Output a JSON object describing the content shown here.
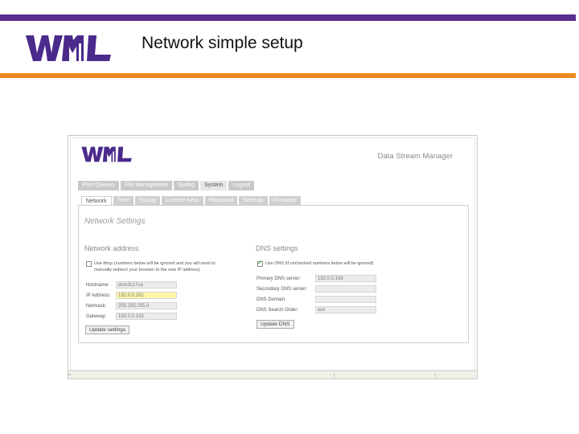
{
  "slide": {
    "title": "Network simple setup",
    "colors": {
      "top_bar": "#5a2d91",
      "bottom_bar": "#f08a1e",
      "logo": "#4b2a8c"
    },
    "logo_icon": "wml-logo"
  },
  "app": {
    "title": "Data Stream Manager",
    "logo_icon": "wml-logo",
    "main_tabs": [
      {
        "label": "Print Queues",
        "active": false
      },
      {
        "label": "File Management",
        "active": false
      },
      {
        "label": "Syslog",
        "active": false
      },
      {
        "label": "System",
        "active": true
      },
      {
        "label": "Logout",
        "active": false
      }
    ],
    "sub_tabs": [
      {
        "label": "Network",
        "active": true
      },
      {
        "label": "Time",
        "active": false
      },
      {
        "label": "Syslog",
        "active": false
      },
      {
        "label": "Licence Keys",
        "active": false
      },
      {
        "label": "Password",
        "active": false
      },
      {
        "label": "Settings",
        "active": false
      },
      {
        "label": "Firmware",
        "active": false
      }
    ],
    "panel_title": "Network Settings",
    "network": {
      "title": "Network address",
      "dhcp_label": "Use dhcp (numbers below will be ignored and you will need to manually redirect your browser to the new IP address)",
      "dhcp_checked": false,
      "fields": [
        {
          "label": "Hostname:",
          "value": "dsm2c17ca",
          "focused": false
        },
        {
          "label": "IP Address:",
          "value": "192.0.0.192",
          "focused": true
        },
        {
          "label": "Netmask:",
          "value": "255.255.255.0",
          "focused": false
        },
        {
          "label": "Gateway:",
          "value": "192.0.0.133",
          "focused": false
        }
      ],
      "button": "Update settings"
    },
    "dns": {
      "title": "DNS settings",
      "dhcp_label": "Use DNS (if unchecked numbers below will be ignored)",
      "dhcp_checked": true,
      "fields": [
        {
          "label": "Primary DNS server:",
          "value": "192.0.0.158"
        },
        {
          "label": "Secondary DNS server:",
          "value": ""
        },
        {
          "label": "DNS Domain:",
          "value": ""
        },
        {
          "label": "DNS Search Order:",
          "value": "wm"
        }
      ],
      "button": "Update DNS"
    },
    "statusbar": {
      "icon": "page-icon"
    }
  }
}
